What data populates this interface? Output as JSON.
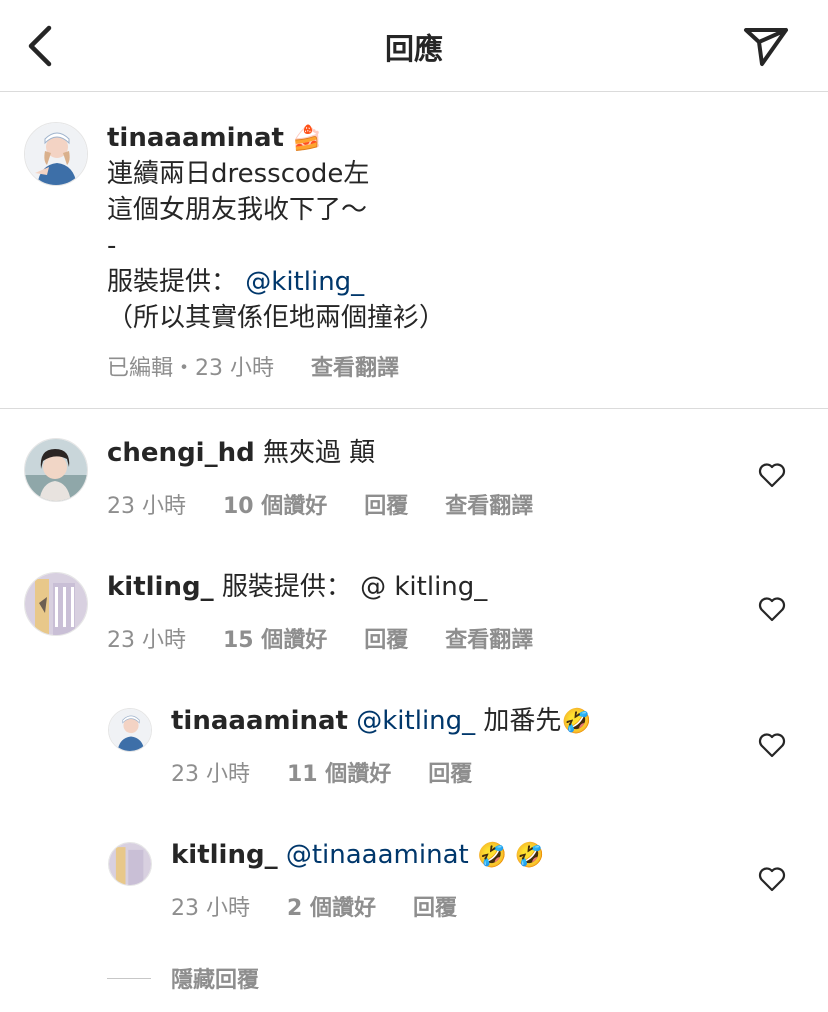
{
  "header": {
    "title": "回應"
  },
  "caption": {
    "username": "tinaaaminat",
    "emoji": "🍰",
    "lines": [
      "連續兩日dresscode左",
      "這個女朋友我收下了～",
      "-"
    ],
    "credit_prefix": "服裝提供：",
    "credit_mention": "@kitling_",
    "last_line": "（所以其實係佢地兩個撞衫）",
    "edited": "已編輯・23 小時",
    "translate": "查看翻譯"
  },
  "comments": [
    {
      "username": "chengi_hd",
      "text": "無夾過 顛",
      "time": "23 小時",
      "likes": "10 個讚好",
      "reply": "回覆",
      "translate": "查看翻譯"
    },
    {
      "username": "kitling_",
      "text": "服裝提供： @ kitling_",
      "time": "23 小時",
      "likes": "15 個讚好",
      "reply": "回覆",
      "translate": "查看翻譯"
    }
  ],
  "replies": [
    {
      "username": "tinaaaminat",
      "mention": "@kitling_",
      "text": "加番先",
      "emoji": "🤣",
      "time": "23 小時",
      "likes": "11 個讚好",
      "reply": "回覆"
    },
    {
      "username": "kitling_",
      "mention": "@tinaaaminat",
      "emoji": "🤣 🤣",
      "time": "23 小時",
      "likes": "2 個讚好",
      "reply": "回覆"
    }
  ],
  "hide_replies": "隱藏回覆",
  "colors": {
    "mention": "#00376b",
    "meta": "#8e8e8e",
    "text": "#262626",
    "divider": "#dbdbdb"
  }
}
